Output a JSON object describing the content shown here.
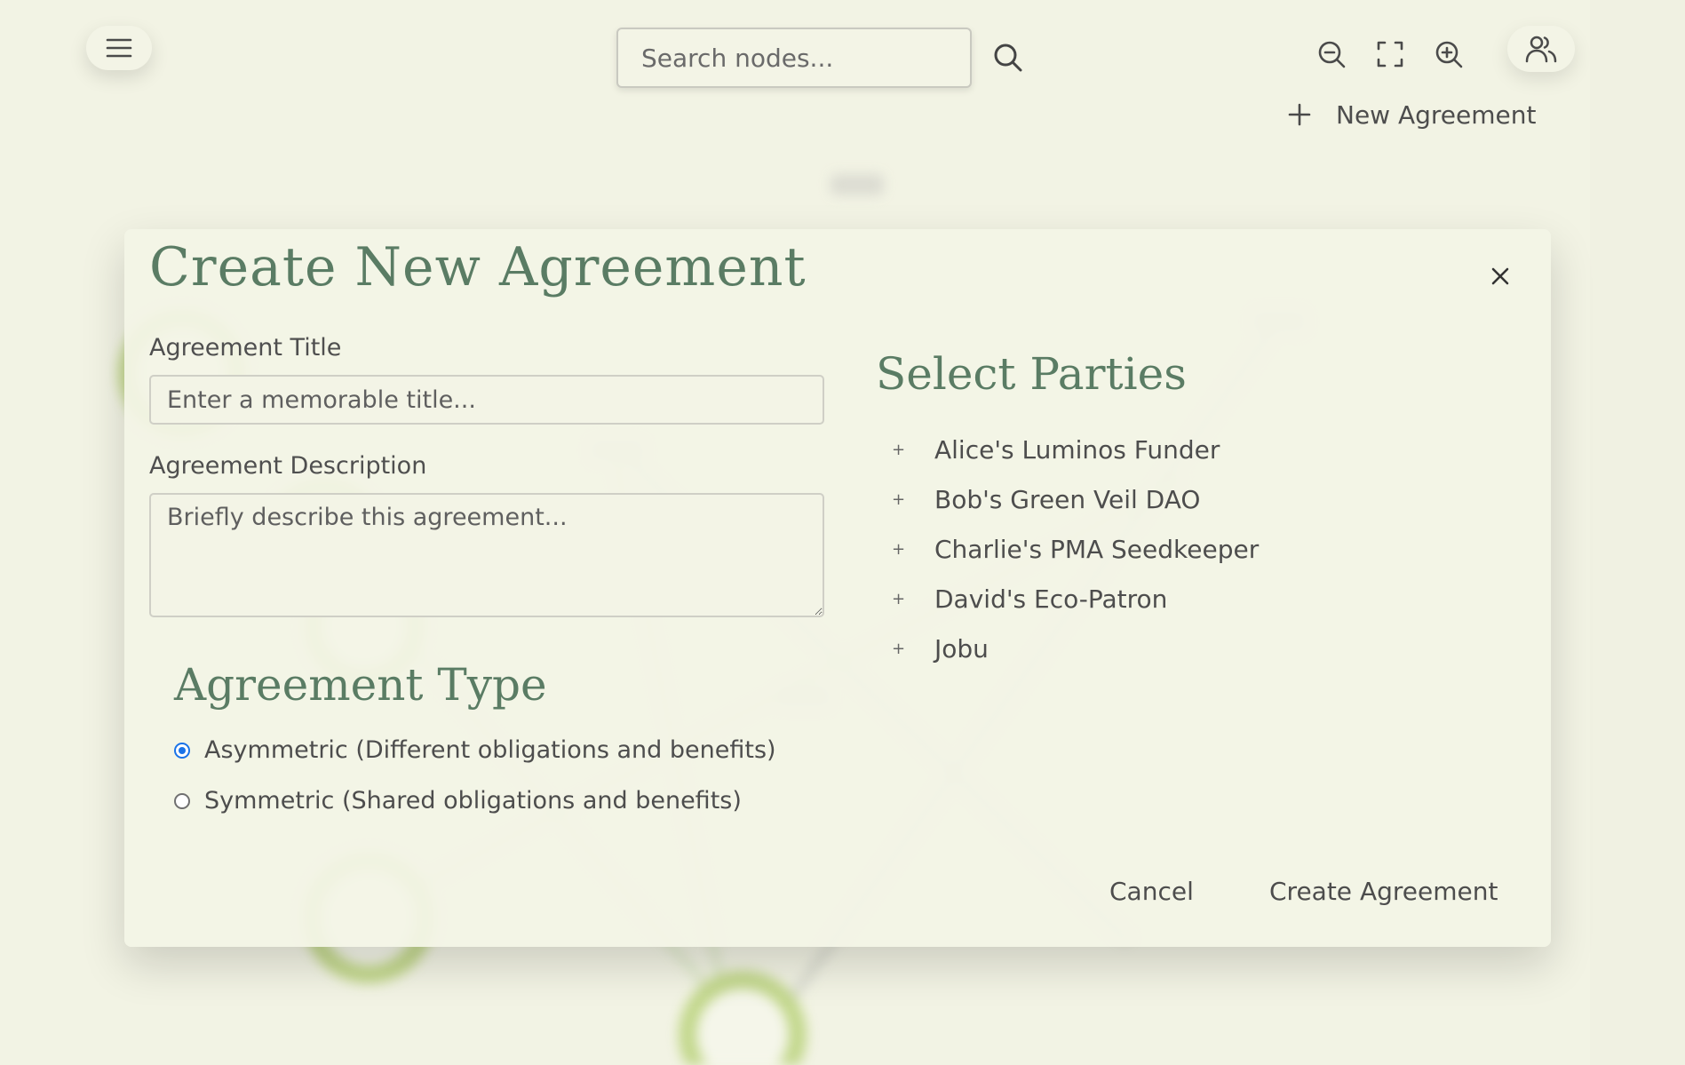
{
  "toolbar": {
    "menu_icon": "hamburger-menu-icon",
    "search_placeholder": "Search nodes...",
    "search_icon": "search-icon",
    "zoom_out_icon": "zoom-out-icon",
    "fit_icon": "fullscreen-icon",
    "zoom_in_icon": "zoom-in-icon",
    "users_icon": "users-icon",
    "new_agreement_label": "New Agreement"
  },
  "modal": {
    "title": "Create New Agreement",
    "close_icon": "close-icon",
    "title_field": {
      "label": "Agreement Title",
      "value": "",
      "placeholder": "Enter a memorable title..."
    },
    "description_field": {
      "label": "Agreement Description",
      "value": "",
      "placeholder": "Briefly describe this agreement..."
    },
    "type_section": {
      "title": "Agreement Type",
      "options": [
        {
          "label": "Asymmetric (Different obligations and benefits)",
          "checked": true
        },
        {
          "label": "Symmetric (Shared obligations and benefits)",
          "checked": false
        }
      ]
    },
    "parties_section": {
      "title": "Select Parties",
      "add_symbol": "+",
      "parties": [
        "Alice's Luminos Funder",
        "Bob's Green Veil DAO",
        "Charlie's PMA Seedkeeper",
        "David's Eco-Patron",
        "Jobu"
      ]
    },
    "cancel_label": "Cancel",
    "create_label": "Create Agreement"
  },
  "colors": {
    "background": "#f2f3e4",
    "accent_heading": "#5a7c64",
    "radio_selected": "#1a73e8",
    "node_ring": "#a9c25a"
  }
}
